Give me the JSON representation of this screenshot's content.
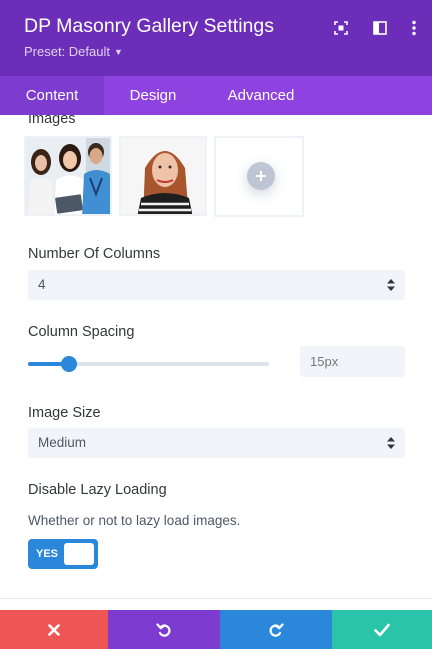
{
  "header": {
    "title": "DP Masonry Gallery Settings",
    "preset_label": "Preset: Default",
    "icons": [
      "expand-icon",
      "sidebar-layout-icon",
      "more-options-icon"
    ]
  },
  "tabs": [
    {
      "label": "Content",
      "active": true
    },
    {
      "label": "Design",
      "active": false
    },
    {
      "label": "Advanced",
      "active": false
    }
  ],
  "images_section": {
    "label": "Images",
    "thumbnails": [
      "group-of-people-photo",
      "woman-portrait-photo"
    ],
    "add_icon": "plus-icon"
  },
  "columns": {
    "label": "Number Of Columns",
    "value": "4"
  },
  "spacing": {
    "label": "Column Spacing",
    "slider_fraction": 0.17,
    "placeholder": "15px"
  },
  "image_size": {
    "label": "Image Size",
    "value": "Medium"
  },
  "lazy_loading": {
    "label": "Disable Lazy Loading",
    "description": "Whether or not to lazy load images.",
    "toggle_text": "YES",
    "enabled": true
  },
  "footer": {
    "buttons": [
      {
        "icon": "close-icon",
        "color": "#ef5555"
      },
      {
        "icon": "undo-icon",
        "color": "#7e3bd0"
      },
      {
        "icon": "redo-icon",
        "color": "#2b87da"
      },
      {
        "icon": "check-icon",
        "color": "#29c4a9"
      }
    ]
  },
  "colors": {
    "header": "#6c2eb9",
    "tabs": "#8e42e0",
    "accent": "#2b87da"
  }
}
